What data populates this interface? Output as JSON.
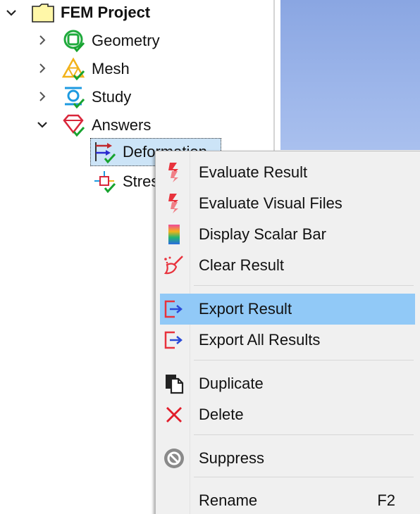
{
  "tree": {
    "root": {
      "label": "FEM Project",
      "expanded": true,
      "icon": "folder-icon"
    },
    "items": [
      {
        "label": "Geometry",
        "icon": "geometry-icon",
        "expanded": false
      },
      {
        "label": "Mesh",
        "icon": "mesh-icon",
        "expanded": false
      },
      {
        "label": "Study",
        "icon": "study-icon",
        "expanded": false
      },
      {
        "label": "Answers",
        "icon": "answers-icon",
        "expanded": true
      }
    ],
    "answers_children": [
      {
        "label": "Deformation",
        "icon": "deformation-result-icon",
        "selected": true
      },
      {
        "label": "Stress",
        "icon": "stress-result-icon",
        "selected": false
      }
    ]
  },
  "context_menu": {
    "items": [
      {
        "label": "Evaluate Result",
        "icon": "evaluate-result-icon"
      },
      {
        "label": "Evaluate Visual Files",
        "icon": "evaluate-visual-files-icon"
      },
      {
        "label": "Display Scalar Bar",
        "icon": "scalar-bar-icon"
      },
      {
        "label": "Clear Result",
        "icon": "broom-icon"
      },
      {
        "label": "Export Result",
        "icon": "export-icon",
        "highlighted": true
      },
      {
        "label": "Export All Results",
        "icon": "export-all-icon"
      },
      {
        "label": "Duplicate",
        "icon": "duplicate-icon"
      },
      {
        "label": "Delete",
        "icon": "delete-icon"
      },
      {
        "label": "Suppress",
        "icon": "suppress-icon"
      },
      {
        "label": "Rename",
        "icon": "rename-icon",
        "shortcut": "F2"
      }
    ]
  },
  "colors": {
    "highlight": "#91c9f7",
    "selection": "#cce4f7",
    "menu_bg": "#f0f0f0",
    "viewport_top": "#8aa6e2",
    "viewport_bottom": "#a9c0ee"
  }
}
